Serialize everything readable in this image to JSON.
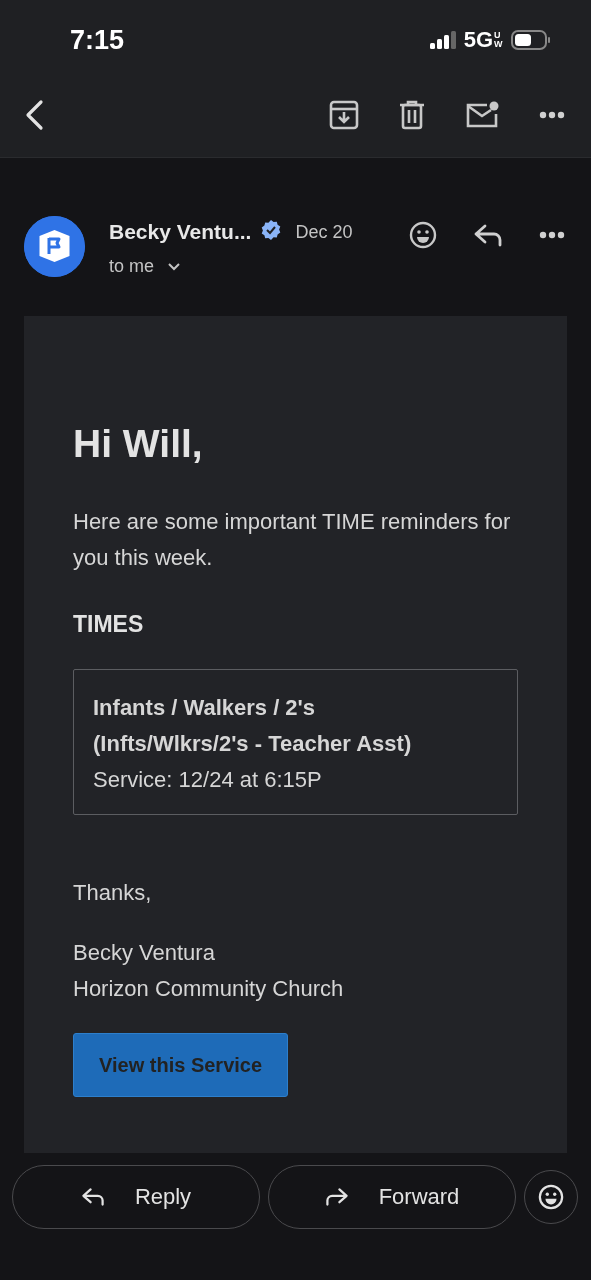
{
  "status_bar": {
    "time": "7:15",
    "network": "5G",
    "network_suffix": "UW"
  },
  "sender": {
    "name": "Becky Ventu...",
    "verified": true,
    "date": "Dec 20",
    "recipient": "to me"
  },
  "message": {
    "greeting": "Hi Will,",
    "intro": "Here are some important TIME reminders for you this week.",
    "section_title": "TIMES",
    "time_entry": {
      "title": "Infants / Walkers / 2's",
      "role": "(Infts/Wlkrs/2's - Teacher Asst)",
      "service": "Service: 12/24 at 6:15P"
    },
    "closing": "Thanks,",
    "signature_name": "Becky Ventura",
    "signature_org": "Horizon Community Church",
    "button": "View this Service"
  },
  "actions": [
    {
      "label": "Reply",
      "kind": "reply"
    },
    {
      "label": "Forward",
      "kind": "forward"
    }
  ]
}
